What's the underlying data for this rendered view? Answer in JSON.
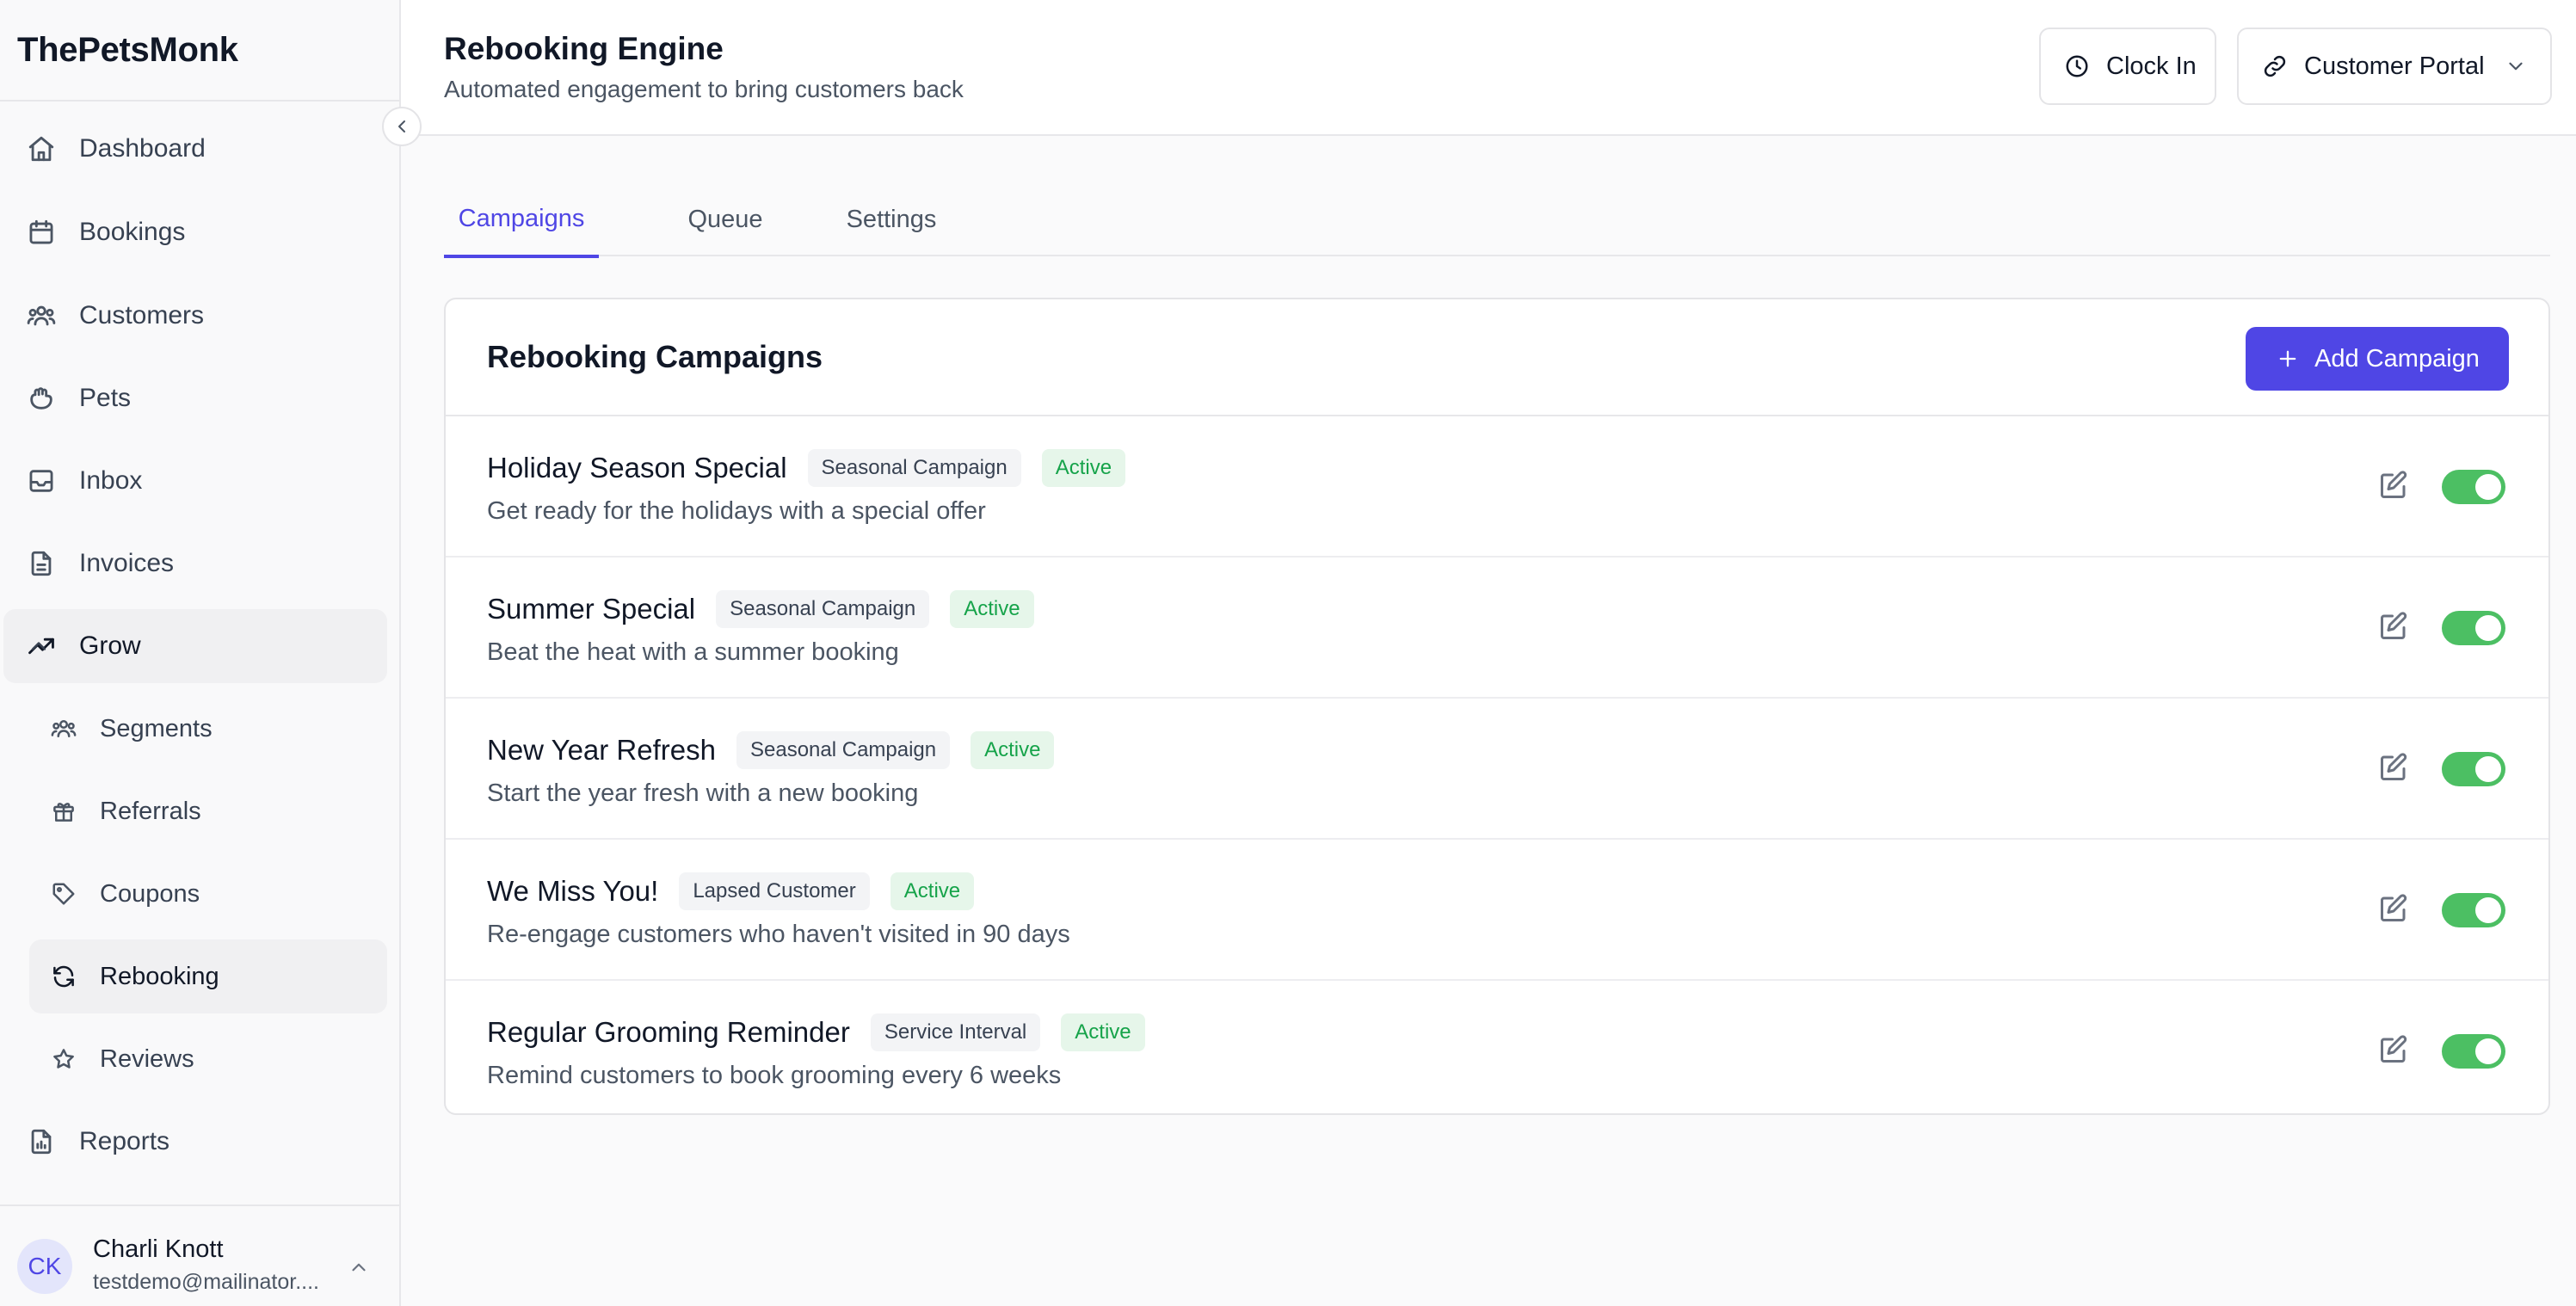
{
  "app": {
    "brand": "ThePetsMonk"
  },
  "sidebar": {
    "items": [
      {
        "label": "Dashboard",
        "icon": "home-icon"
      },
      {
        "label": "Bookings",
        "icon": "calendar-icon"
      },
      {
        "label": "Customers",
        "icon": "users-icon"
      },
      {
        "label": "Pets",
        "icon": "paw-icon"
      },
      {
        "label": "Inbox",
        "icon": "inbox-icon"
      },
      {
        "label": "Invoices",
        "icon": "file-icon"
      },
      {
        "label": "Grow",
        "icon": "trending-up-icon",
        "expanded": true
      },
      {
        "label": "Reports",
        "icon": "report-icon"
      }
    ],
    "grow_items": [
      {
        "label": "Segments",
        "icon": "users-icon"
      },
      {
        "label": "Referrals",
        "icon": "gift-icon"
      },
      {
        "label": "Coupons",
        "icon": "tag-icon"
      },
      {
        "label": "Rebooking",
        "icon": "refresh-icon",
        "active": true
      },
      {
        "label": "Reviews",
        "icon": "star-icon"
      }
    ],
    "user": {
      "initials": "CK",
      "name": "Charli Knott",
      "email": "testdemo@mailinator...."
    }
  },
  "header": {
    "title": "Rebooking Engine",
    "subtitle": "Automated engagement to bring customers back",
    "clock_in_label": "Clock In",
    "portal_label": "Customer Portal"
  },
  "tabs": [
    {
      "label": "Campaigns",
      "active": true
    },
    {
      "label": "Queue",
      "active": false
    },
    {
      "label": "Settings",
      "active": false
    }
  ],
  "campaigns_card": {
    "title": "Rebooking Campaigns",
    "add_label": "Add Campaign",
    "rows": [
      {
        "name": "Holiday Season Special",
        "type": "Seasonal Campaign",
        "status": "Active",
        "description": "Get ready for the holidays with a special offer",
        "enabled": true
      },
      {
        "name": "Summer Special",
        "type": "Seasonal Campaign",
        "status": "Active",
        "description": "Beat the heat with a summer booking",
        "enabled": true
      },
      {
        "name": "New Year Refresh",
        "type": "Seasonal Campaign",
        "status": "Active",
        "description": "Start the year fresh with a new booking",
        "enabled": true
      },
      {
        "name": "We Miss You!",
        "type": "Lapsed Customer",
        "status": "Active",
        "description": "Re-engage customers who haven't visited in 90 days",
        "enabled": true
      },
      {
        "name": "Regular Grooming Reminder",
        "type": "Service Interval",
        "status": "Active",
        "description": "Remind customers to book grooming every 6 weeks",
        "enabled": true
      }
    ]
  },
  "colors": {
    "accent": "#4f46e5",
    "toggle_on": "#4cbf63",
    "status_green": "#16a34a"
  }
}
